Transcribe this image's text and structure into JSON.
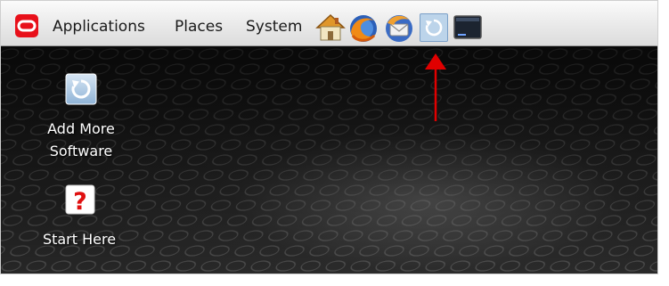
{
  "panel": {
    "logo_icon": "oracle-logo-icon",
    "menus": [
      "Applications",
      "Places",
      "System"
    ],
    "launchers": [
      "home-folder-icon",
      "firefox-icon",
      "thunderbird-icon",
      "add-more-software-icon",
      "terminal-icon"
    ]
  },
  "desktop": {
    "icons": [
      {
        "label_line1": "Add More",
        "label_line2": "Software",
        "icon": "software-update-icon"
      },
      {
        "label_line1": "Start Here",
        "icon": "help-question-icon"
      }
    ]
  },
  "annotation": {
    "icon": "red-arrow-icon",
    "color": "#e00000"
  },
  "colors": {
    "oracle_red": "#e8101a",
    "desktop_dark": "#1a1a1a"
  }
}
